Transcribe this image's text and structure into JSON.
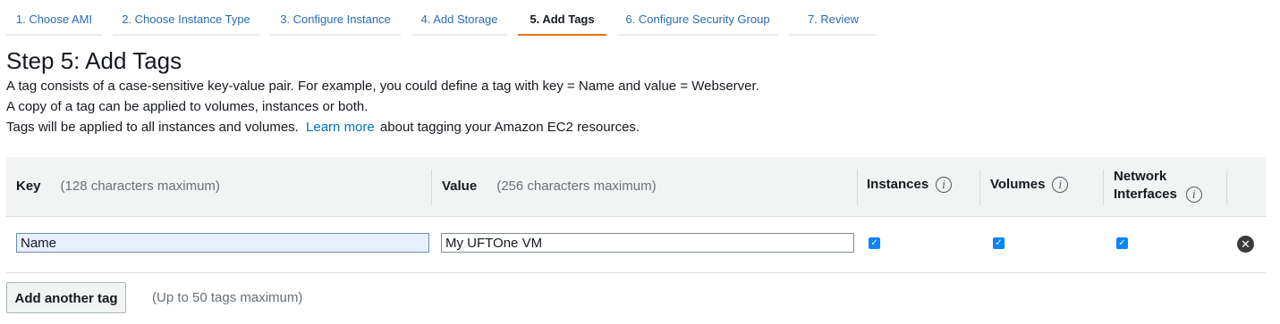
{
  "wizard": {
    "steps": [
      {
        "label": "1. Choose AMI"
      },
      {
        "label": "2. Choose Instance Type"
      },
      {
        "label": "3. Configure Instance"
      },
      {
        "label": "4. Add Storage"
      },
      {
        "label": "5. Add Tags",
        "active": true
      },
      {
        "label": "6. Configure Security Group"
      },
      {
        "label": "7. Review"
      }
    ]
  },
  "page": {
    "title": "Step 5: Add Tags",
    "line1": "A tag consists of a case-sensitive key-value pair. For example, you could define a tag with key = Name and value = Webserver.",
    "line2": "A copy of a tag can be applied to volumes, instances or both.",
    "line3_before": "Tags will be applied to all instances and volumes.",
    "line3_link": "Learn more",
    "line3_after": "about tagging your Amazon EC2 resources."
  },
  "table": {
    "headers": {
      "key": "Key",
      "key_hint": "(128 characters maximum)",
      "value": "Value",
      "value_hint": "(256 characters maximum)",
      "instances": "Instances",
      "volumes": "Volumes",
      "network_line1": "Network",
      "network_line2": "Interfaces",
      "info_glyph": "i"
    },
    "rows": [
      {
        "key": "Name",
        "value": "My UFTOne VM",
        "instances": true,
        "volumes": true,
        "network_interfaces": true
      }
    ]
  },
  "actions": {
    "add_tag_label": "Add another tag",
    "add_tag_note": "(Up to 50 tags maximum)"
  },
  "icons": {
    "check": "✓",
    "remove": "✕"
  },
  "colors": {
    "accent": "#ec7211",
    "link": "#0073bb",
    "checkbox": "#0a84ff"
  }
}
